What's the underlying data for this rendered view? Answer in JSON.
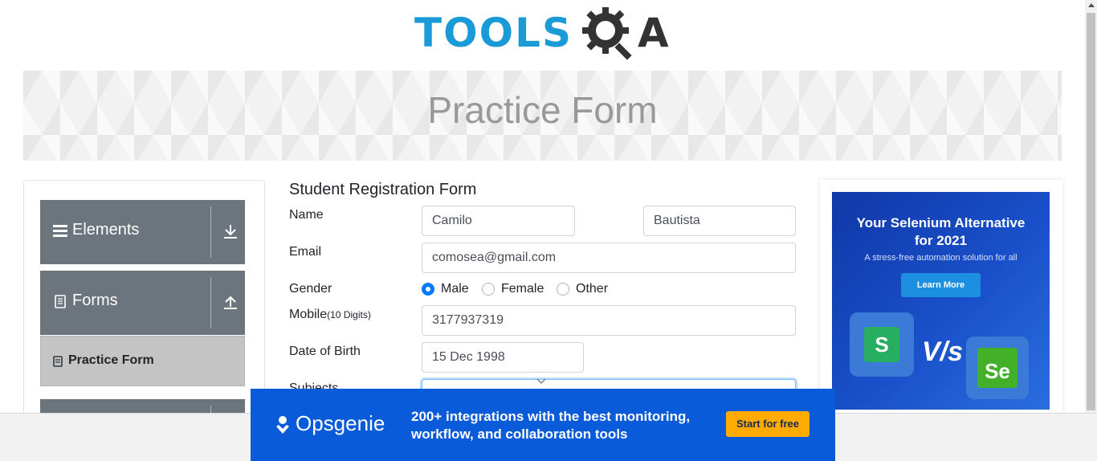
{
  "logo": {
    "tools_text": "TOOLS",
    "qa_letter": "A",
    "colors": {
      "tools": "#1a9ad6",
      "qa": "#333333"
    }
  },
  "banner": {
    "title": "Practice Form"
  },
  "sidebar": {
    "groups": [
      {
        "label": "Elements",
        "icon": "hamburger-icon",
        "arrow": "download-arrow-icon"
      },
      {
        "label": "Forms",
        "icon": "document-icon",
        "arrow": "upload-arrow-icon"
      }
    ],
    "active_item": {
      "label": "Practice Form",
      "icon": "form-icon"
    }
  },
  "form": {
    "title": "Student Registration Form",
    "name_label": "Name",
    "first_name": "Camilo",
    "last_name": "Bautista",
    "email_label": "Email",
    "email": "comosea@gmail.com",
    "gender_label": "Gender",
    "genders": [
      {
        "label": "Male",
        "checked": true
      },
      {
        "label": "Female",
        "checked": false
      },
      {
        "label": "Other",
        "checked": false
      }
    ],
    "mobile_label": "Mobile",
    "mobile_hint": "(10 Digits)",
    "mobile": "3177937319",
    "dob_label": "Date of Birth",
    "dob": "15 Dec 1998",
    "subjects_label": "Subjects"
  },
  "side_ad": {
    "title_line1": "Your Selenium Alternative",
    "title_line2": "for 2021",
    "subtitle": "A stress-free automation solution for all",
    "button": "Learn More",
    "vs_text": "V/s",
    "left_tile": "S",
    "right_tile": "Se"
  },
  "bottom_ad": {
    "brand": "Opsgenie",
    "headline_line1": "200+ integrations with the best monitoring,",
    "headline_line2": "workflow, and collaboration tools",
    "button": "Start for free",
    "colors": {
      "background": "#0a5bd9",
      "button": "#ffab00"
    }
  }
}
